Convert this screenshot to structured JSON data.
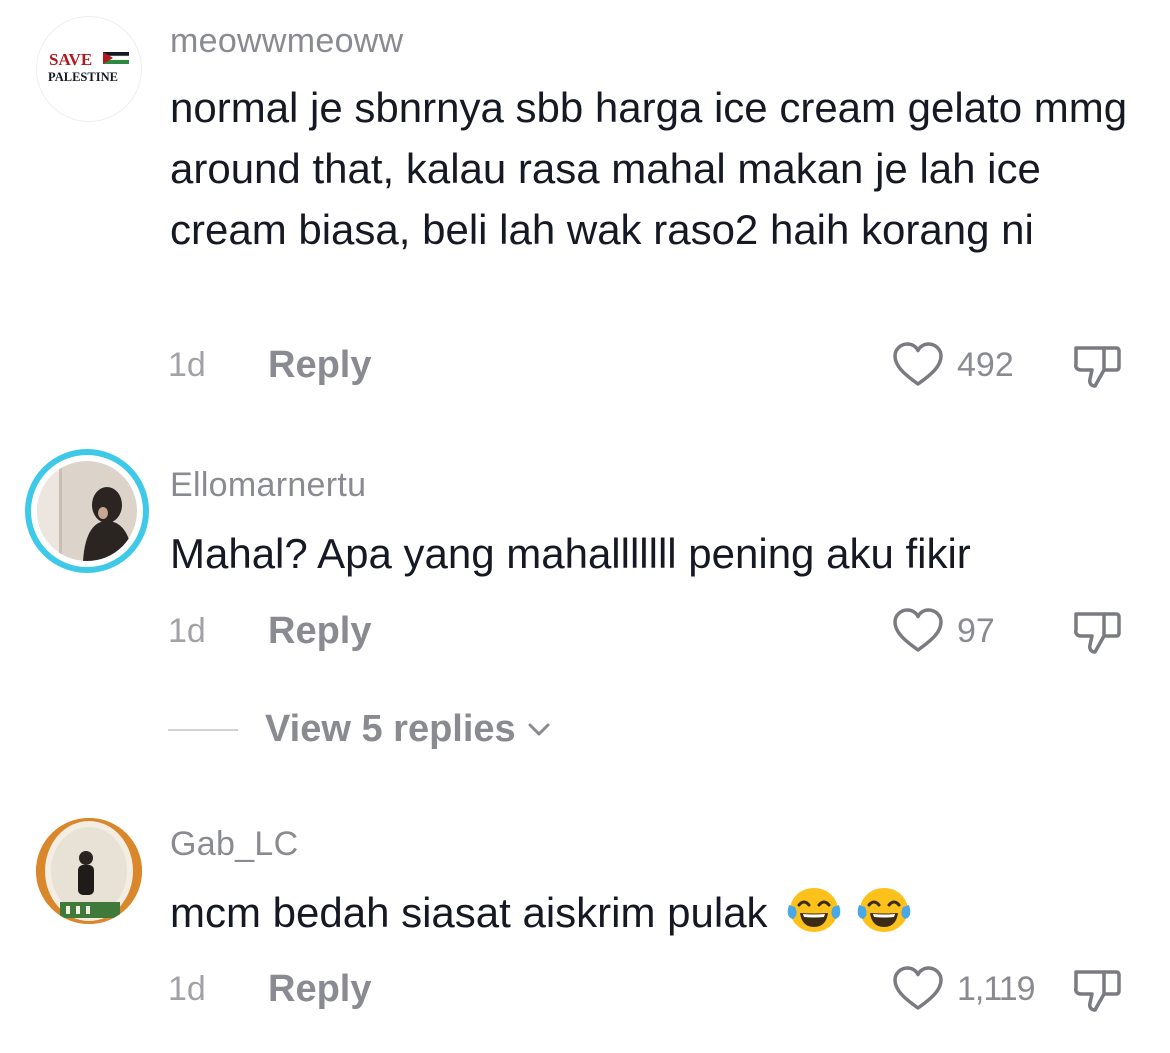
{
  "comments": [
    {
      "username": "meowwmeoww",
      "avatar": {
        "badge_line1": "SAVE",
        "badge_line2": "PALESTINE",
        "colors": {
          "text": "#b3181f",
          "dark": "#161823"
        }
      },
      "text": "normal je sbnrnya sbb harga ice cream gelato mmg around that, kalau rasa mahal makan je lah ice cream biasa, beli lah wak raso2 haih korang ni",
      "age": "1d",
      "reply_label": "Reply",
      "likes": "492"
    },
    {
      "username": "Ellomarnertu",
      "text": "Mahal? Apa yang mahalllllll pening aku fikir",
      "age": "1d",
      "reply_label": "Reply",
      "likes": "97",
      "view_replies_label": "View 5 replies"
    },
    {
      "username": "Gab_LC",
      "text": "mcm bedah siasat aiskrim pulak",
      "emoji": [
        "face-with-tears-of-joy",
        "face-with-tears-of-joy"
      ],
      "age": "1d",
      "reply_label": "Reply",
      "likes": "1,119"
    }
  ],
  "colors": {
    "primary_text": "#161823",
    "secondary_text": "#8a8b91",
    "story_ring": "#3ec9e8",
    "emoji_yellow": "#fcc21b"
  }
}
